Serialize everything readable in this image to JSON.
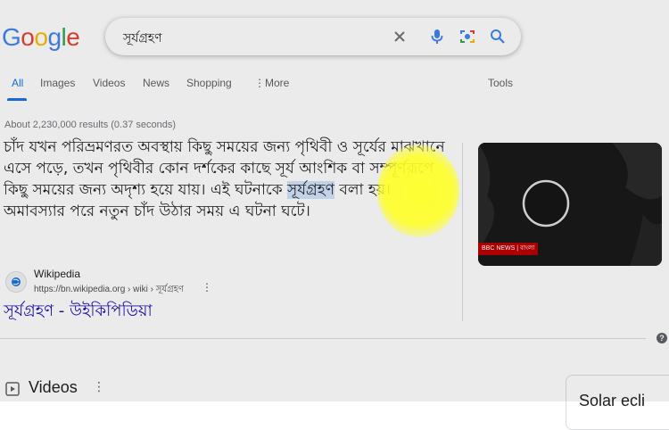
{
  "logo": {
    "text": "Google"
  },
  "search": {
    "query": "সূর্যগ্রহণ"
  },
  "tabs": [
    {
      "label": "All"
    },
    {
      "label": "Images"
    },
    {
      "label": "Videos"
    },
    {
      "label": "News"
    },
    {
      "label": "Shopping"
    },
    {
      "label": "More"
    },
    {
      "label": "Tools"
    }
  ],
  "result_stats": "About 2,230,000 results (0.37 seconds)",
  "snippet": {
    "part1": "চাঁদ যখন পরিভ্রমণরত অবস্থায় কিছু সময়ের জন্য পৃথিবী ও সূর্যের মাঝখানে এসে পড়ে, তখন পৃথিবীর কোন দর্শকের কাছে সূর্য আংশিক বা সম্পূর্ণরূপে কিছু সময়ের জন্য অদৃশ্য হয়ে যায়। এই ঘটনাকে ",
    "highlight": "সূর্যগ্রহণ",
    "part2": " বলা হয়। অমাবস্যার পরে নতুন চাঁদ উঠার সময় এ ঘটনা ঘটে।"
  },
  "source": {
    "name": "Wikipedia",
    "url": "https://bn.wikipedia.org › wiki › সূর্যগ্রহণ"
  },
  "result_title": "সূর্যগ্রহণ - উইকিপিডিয়া",
  "thumbnail": {
    "badge": "BBC NEWS | বাংলা"
  },
  "videos": {
    "label": "Videos"
  },
  "side_card": {
    "label": "Solar ecli"
  },
  "colors": {
    "link": "#1a0dab",
    "accent": "#1a73e8",
    "highlight": "#d2e3fc",
    "cursor_spot": "#ffff28"
  }
}
